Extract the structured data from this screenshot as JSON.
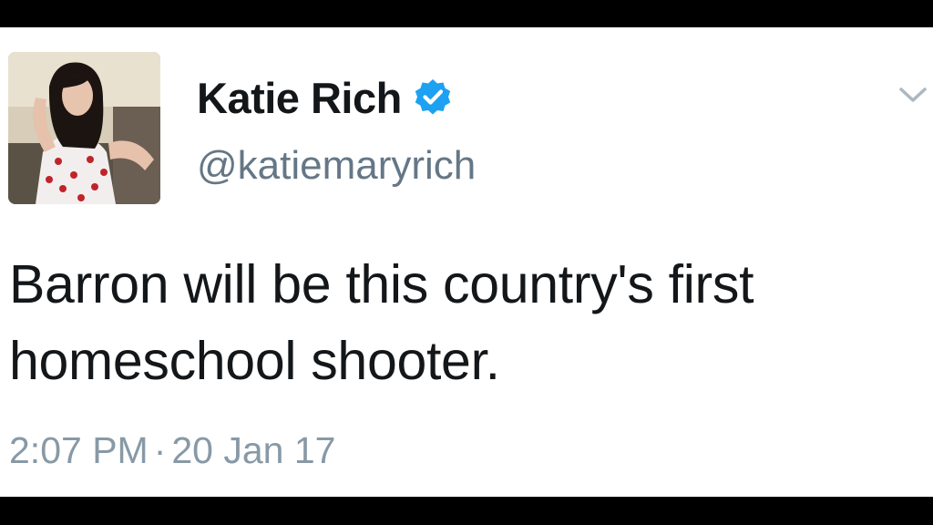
{
  "tweet": {
    "author": {
      "display_name": "Katie Rich",
      "handle": "@katiemaryrich",
      "verified": true,
      "avatar_icon": "profile-photo"
    },
    "text_lines": [
      "Barron will be this country's first",
      "homeschool shooter."
    ],
    "time": "2:07 PM",
    "separator": "·",
    "date": "20 Jan 17",
    "menu_icon": "chevron-down-icon"
  },
  "colors": {
    "verified_blue": "#1da1f2",
    "text_primary": "#14171a",
    "text_secondary": "#657786",
    "timestamp": "#8899a6",
    "background": "#ffffff",
    "frame": "#000000"
  }
}
